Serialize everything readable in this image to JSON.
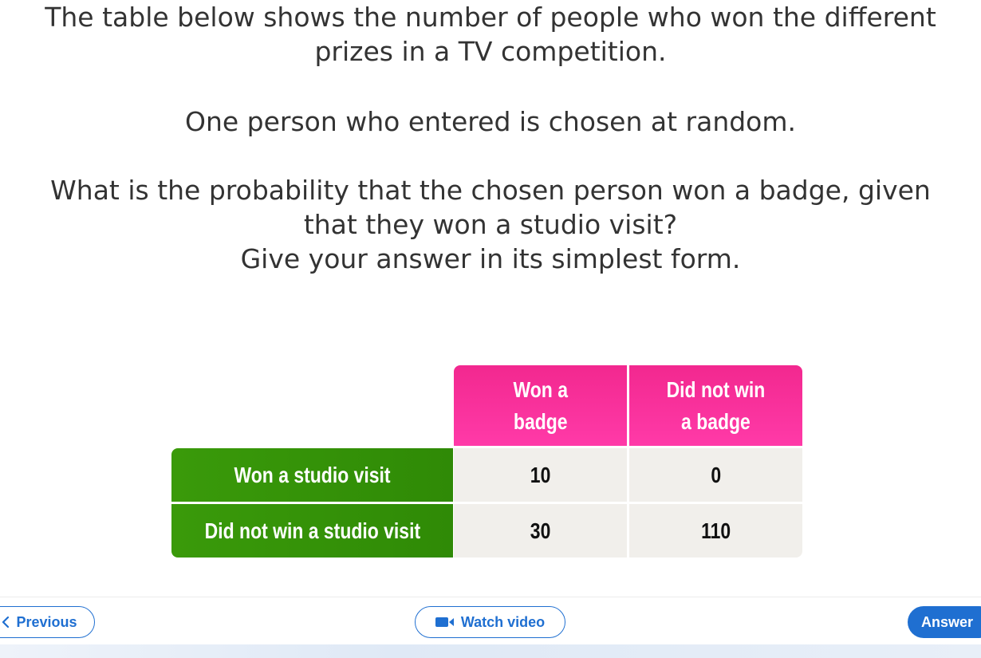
{
  "question": {
    "para1_line1": "The table below shows the number of people who won the different",
    "para1_line2": "prizes in a TV competition.",
    "para2_line1": "One person who entered is chosen at random.",
    "para3_line1": "What is the probability that the chosen person won a badge, given",
    "para3_line2": "that they won a studio visit?",
    "para3_line3": "Give your answer in its simplest form."
  },
  "table": {
    "col_headers": [
      "Won a\nbadge",
      "Did not win\na badge"
    ],
    "col_header_lines": [
      [
        "Won a",
        "badge"
      ],
      [
        "Did not win",
        "a badge"
      ]
    ],
    "rows": [
      {
        "label": "Won a studio visit",
        "values": [
          "10",
          "0"
        ]
      },
      {
        "label": "Did not win a studio visit",
        "values": [
          "30",
          "110"
        ]
      }
    ],
    "colors": {
      "header_pink": "#f2288f",
      "row_green": "#3a9a0a",
      "cell_bg": "#f1efeb"
    }
  },
  "nav": {
    "previous_label": "Previous",
    "watch_video_label": "Watch video",
    "answer_label": "Answer",
    "accent_color": "#1f6fd1"
  },
  "icons": {
    "previous": "chevron-left-icon",
    "video": "video-camera-icon"
  }
}
